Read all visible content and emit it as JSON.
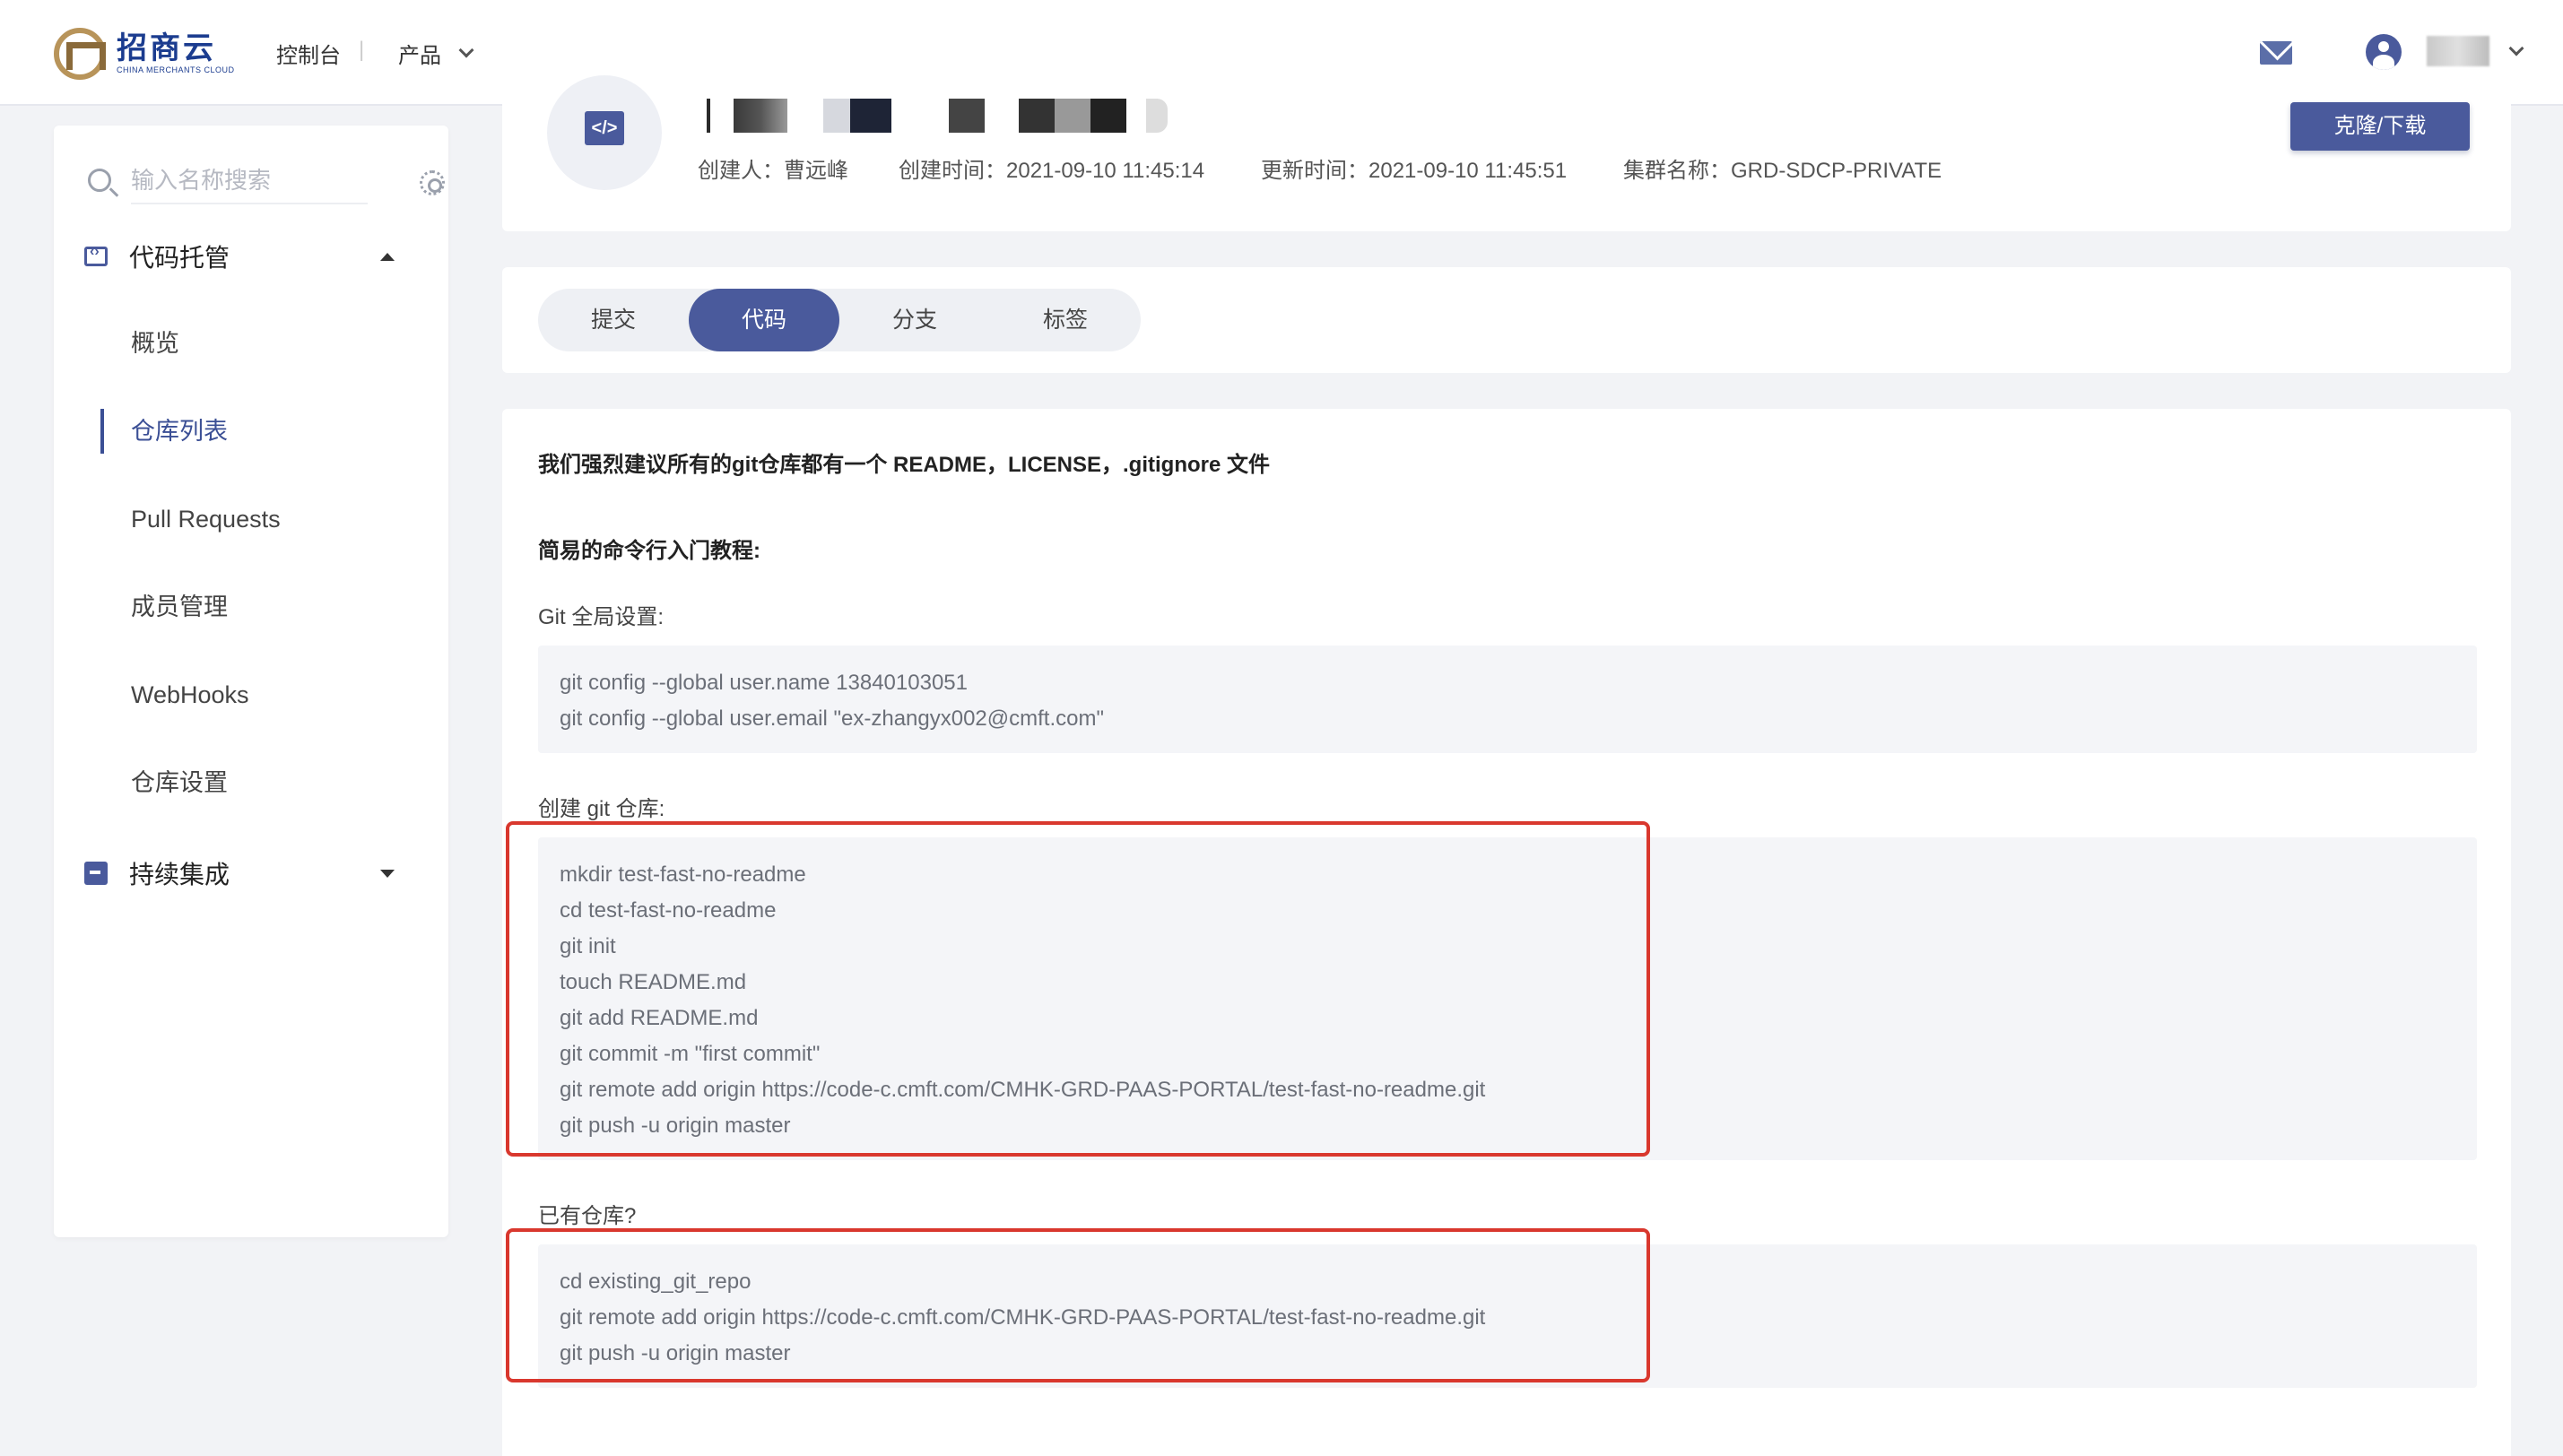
{
  "topbar": {
    "logo_text": "招商云",
    "logo_subtext": "CHINA MERCHANTS CLOUD",
    "console_label": "控制台",
    "separator": "|",
    "product_label": "产品"
  },
  "sidebar": {
    "search_placeholder": "输入名称搜索",
    "group_code": "代码托管",
    "items": [
      {
        "label": "概览"
      },
      {
        "label": "仓库列表"
      },
      {
        "label": "Pull Requests"
      },
      {
        "label": "成员管理"
      },
      {
        "label": "WebHooks"
      },
      {
        "label": "仓库设置"
      }
    ],
    "active_item": "仓库列表",
    "group_ci": "持续集成"
  },
  "repo": {
    "creator_label": "创建人：",
    "creator": "曹远峰",
    "created_label": "创建时间：",
    "created": "2021-09-10 11:45:14",
    "updated_label": "更新时间：",
    "updated": "2021-09-10 11:45:51",
    "cluster_label": "集群名称：",
    "cluster": "GRD-SDCP-PRIVATE",
    "clone_button": "克隆/下载"
  },
  "tabs": [
    {
      "label": "提交"
    },
    {
      "label": "代码"
    },
    {
      "label": "分支"
    },
    {
      "label": "标签"
    }
  ],
  "active_tab": "代码",
  "content": {
    "recommend": "我们强烈建议所有的git仓库都有一个 README，LICENSE，.gitignore 文件",
    "tutorial_heading": "简易的命令行入门教程:",
    "global_setup_label": "Git 全局设置:",
    "global_setup_lines": [
      "git config --global user.name 13840103051",
      "git config --global user.email \"ex-zhangyx002@cmft.com\""
    ],
    "create_repo_label": "创建 git 仓库:",
    "create_repo_lines": [
      "mkdir test-fast-no-readme",
      "cd test-fast-no-readme",
      "git init",
      "touch README.md",
      "git add README.md",
      "git commit -m \"first commit\"",
      "git remote add origin https://code-c.cmft.com/CMHK-GRD-PAAS-PORTAL/test-fast-no-readme.git",
      "git push -u origin master"
    ],
    "existing_repo_label": "已有仓库?",
    "existing_repo_lines": [
      "cd existing_git_repo",
      "git remote add origin https://code-c.cmft.com/CMHK-GRD-PAAS-PORTAL/test-fast-no-readme.git",
      "git push -u origin master"
    ]
  },
  "colors": {
    "accent": "#4a5a9c",
    "highlight": "#d9382e",
    "background": "#f2f3f6"
  }
}
